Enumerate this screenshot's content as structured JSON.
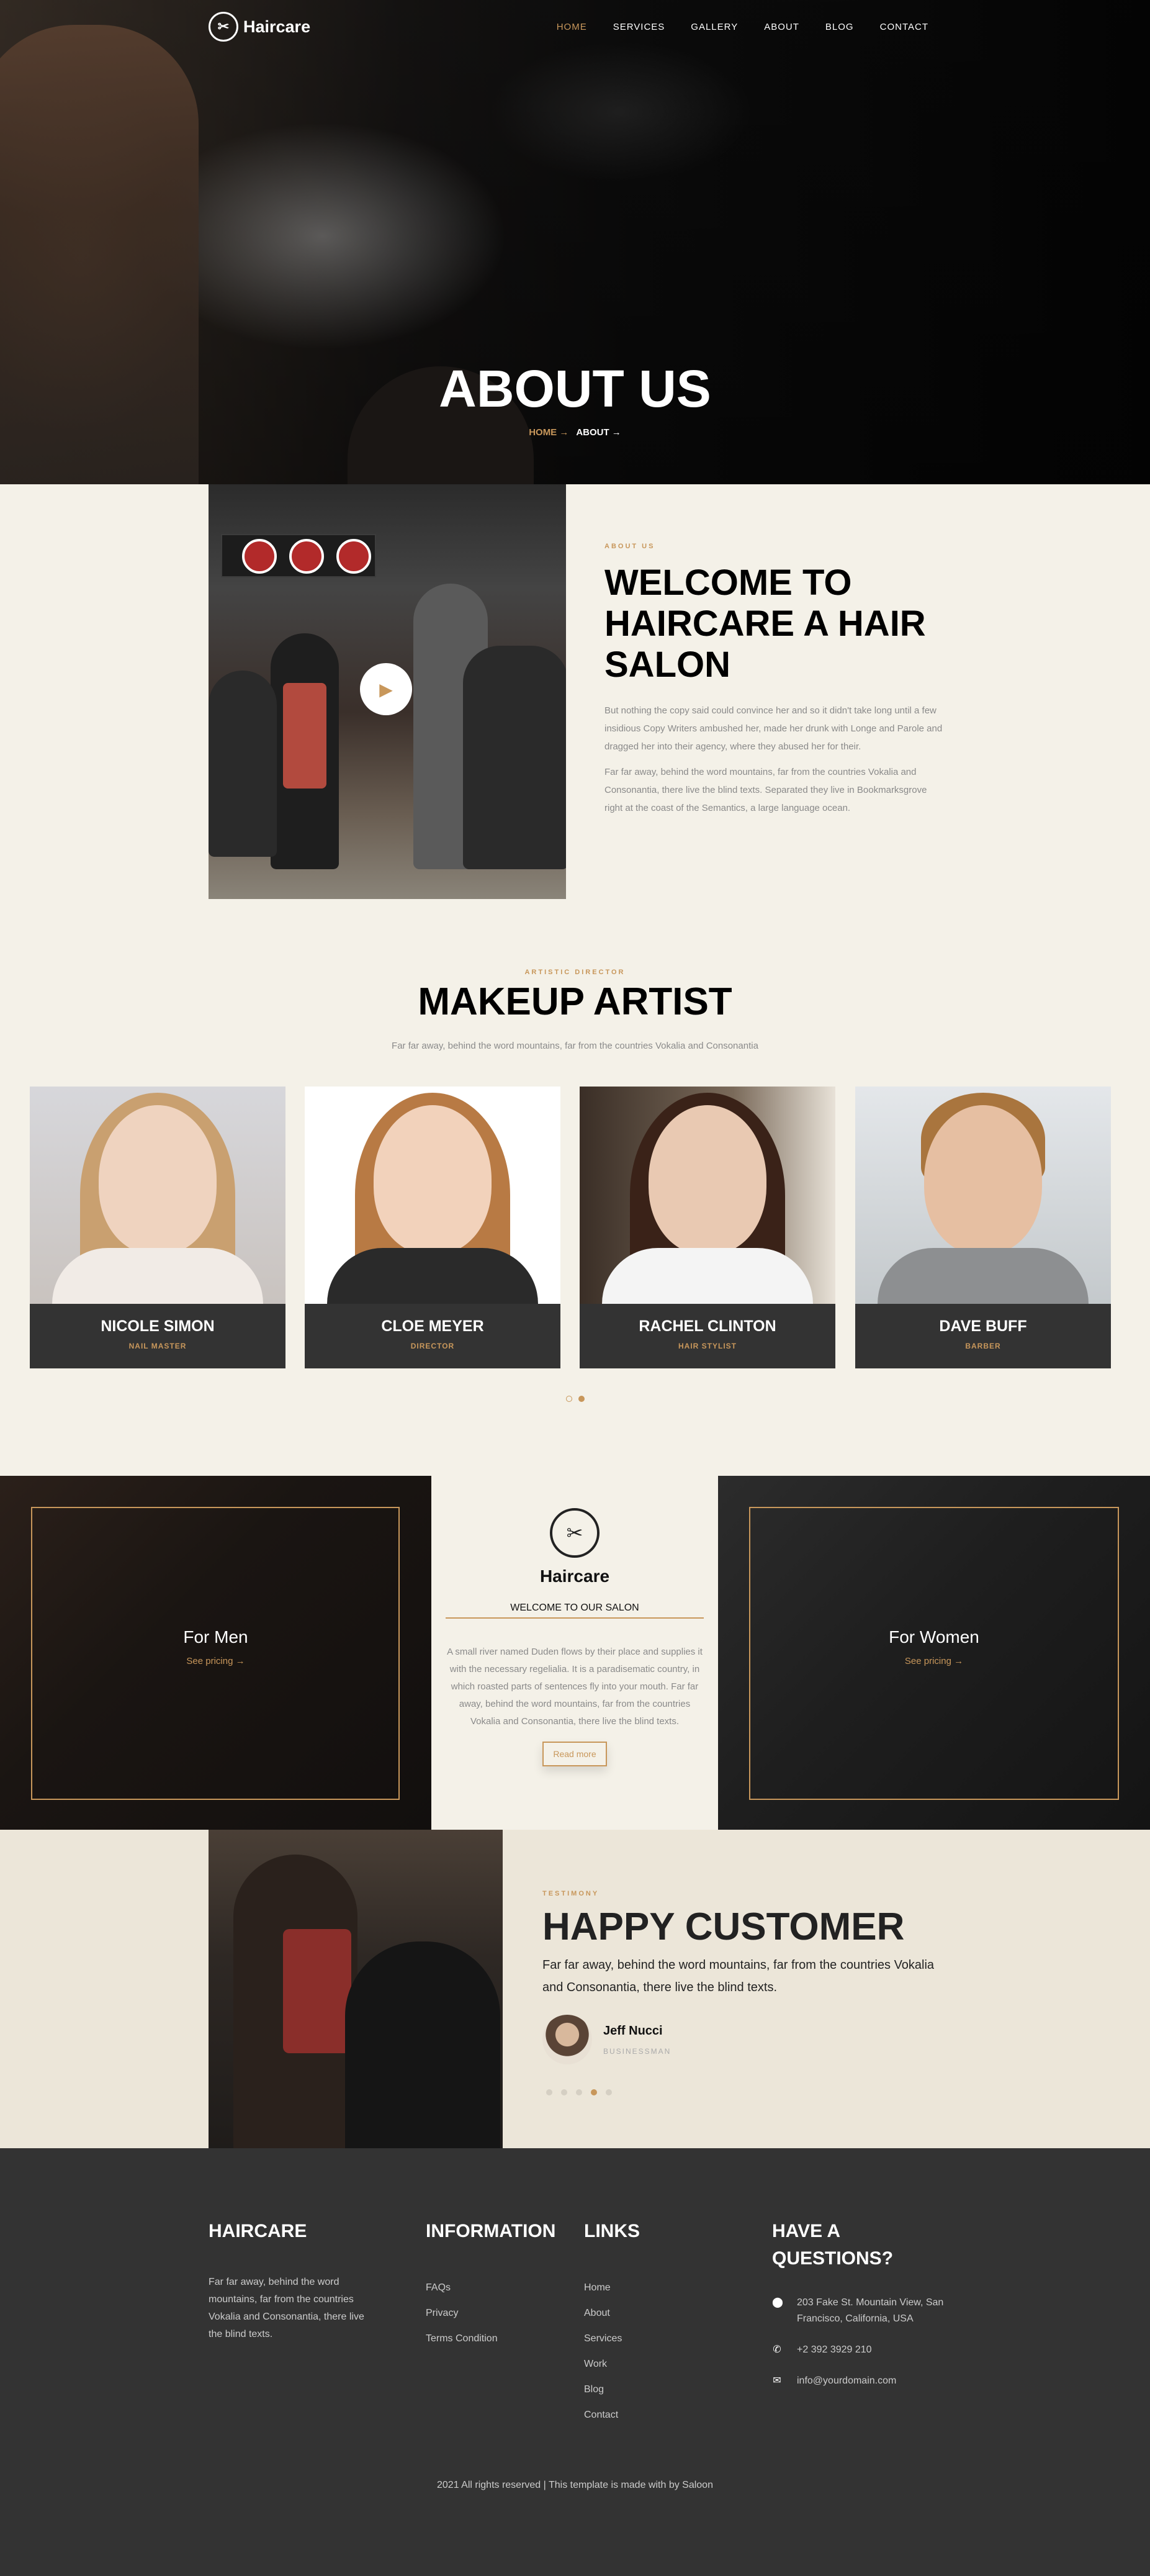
{
  "brand": {
    "name": "Haircare"
  },
  "nav": {
    "items": [
      "HOME",
      "SERVICES",
      "GALLERY",
      "ABOUT",
      "BLOG",
      "CONTACT"
    ]
  },
  "hero": {
    "title": "ABOUT US",
    "crumb_home": "HOME →",
    "crumb_current": "ABOUT →"
  },
  "about": {
    "kicker": "ABOUT US",
    "title": "WELCOME TO HAIRCARE A HAIR SALON",
    "p1": "But nothing the copy said could convince her and so it didn't take long until a few insidious Copy Writers ambushed her, made her drunk with Longe and Parole and dragged her into their agency, where they abused her for their.",
    "p2": "Far far away, behind the word mountains, far from the countries Vokalia and Consonantia, there live the blind texts. Separated they live in Bookmarksgrove right at the coast of the Semantics, a large language ocean."
  },
  "team": {
    "kicker": "ARTISTIC DIRECTOR",
    "title": "MAKEUP ARTIST",
    "subtitle": "Far far away, behind the word mountains, far from the countries Vokalia and Consonantia",
    "members": [
      {
        "name": "NICOLE SIMON",
        "role": "NAIL MASTER"
      },
      {
        "name": "CLOE MEYER",
        "role": "DIRECTOR"
      },
      {
        "name": "RACHEL CLINTON",
        "role": "HAIR STYLIST"
      },
      {
        "name": "DAVE BUFF",
        "role": "BARBER"
      }
    ]
  },
  "services": {
    "men": {
      "label": "For Men",
      "link": "See pricing →"
    },
    "women": {
      "label": "For Women",
      "link": "See pricing →"
    },
    "brand": "Haircare",
    "subtitle": "WELCOME TO OUR SALON",
    "text": "A small river named Duden flows by their place and supplies it with the necessary regelialia. It is a paradisematic country, in which roasted parts of sentences fly into your mouth. Far far away, behind the word mountains, far from the countries Vokalia and Consonantia, there live the blind texts.",
    "button": "Read more"
  },
  "testimony": {
    "kicker": "TESTIMONY",
    "title": "HAPPY CUSTOMER",
    "quote": "Far far away, behind the word mountains, far from the countries Vokalia and Consonantia, there live the blind texts.",
    "name": "Jeff Nucci",
    "role": "BUSINESSMAN"
  },
  "footer": {
    "col1": {
      "title": "HAIRCARE",
      "text": "Far far away, behind the word mountains, far from the countries Vokalia and Consonantia, there live the blind texts."
    },
    "col2": {
      "title": "INFORMATION",
      "items": [
        "FAQs",
        "Privacy",
        "Terms Condition"
      ]
    },
    "col3": {
      "title": "LINKS",
      "items": [
        "Home",
        "About",
        "Services",
        "Work",
        "Blog",
        "Contact"
      ]
    },
    "col4": {
      "title": "HAVE A QUESTIONS?",
      "address": "203 Fake St. Mountain View, San Francisco, California, USA",
      "phone": "+2 392 3929 210",
      "email": "info@yourdomain.com"
    },
    "copyright": "2021 All rights reserved | This template is made with by Saloon"
  },
  "colors": {
    "accent": "#c8975b",
    "dark": "#333333",
    "cream": "#f4f1e8"
  }
}
